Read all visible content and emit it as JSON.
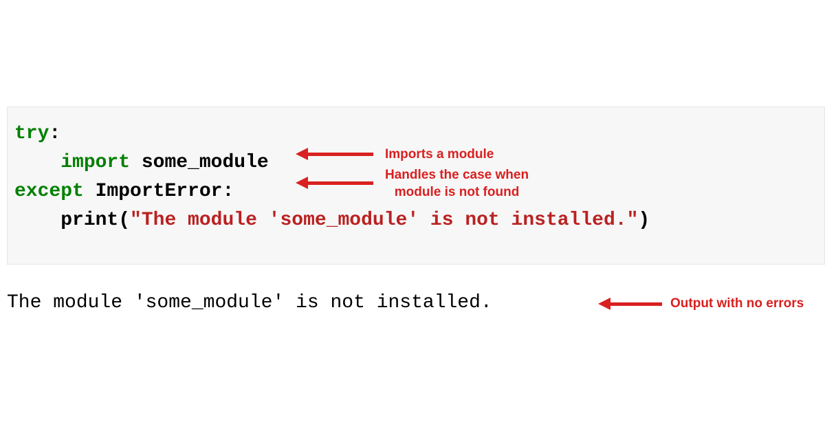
{
  "code": {
    "line1_kw": "try",
    "line1_colon": ":",
    "line2_indent": "    ",
    "line2_kw": "import",
    "line2_rest": " some_module",
    "line3_kw": "except",
    "line3_rest": " ImportError:",
    "line4_indent": "    ",
    "line4_func": "print(",
    "line4_str": "\"The module 'some_module' is not installed.\"",
    "line4_close": ")"
  },
  "output": {
    "text": "The module 'some_module' is not installed."
  },
  "annotations": {
    "a1": "Imports a module",
    "a2_line1": "Handles the case when",
    "a2_line2": "module is not found",
    "a3": "Output with no errors"
  }
}
